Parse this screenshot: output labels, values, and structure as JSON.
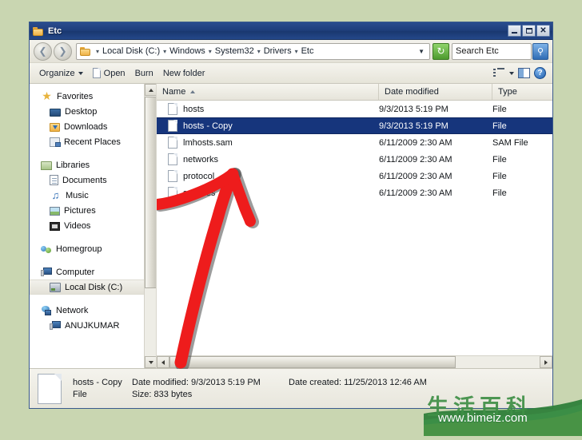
{
  "window": {
    "title": "Etc",
    "controls": {
      "minimize": "Minimize",
      "maximize": "Maximize",
      "close": "Close"
    }
  },
  "address_bar": {
    "back_label": "Back",
    "forward_label": "Forward",
    "breadcrumb": [
      "Local Disk (C:)",
      "Windows",
      "System32",
      "Drivers",
      "Etc"
    ],
    "separator": "▾",
    "dropdown_icon": "chevron-down",
    "refresh_icon": "↻"
  },
  "search": {
    "value": "Search Etc",
    "placeholder": "Search Etc",
    "icon": "search-icon"
  },
  "toolbar": {
    "organize_label": "Organize",
    "open_label": "Open",
    "burn_label": "Burn",
    "new_folder_label": "New folder",
    "view_icon": "list-view-icon",
    "view_dropdown_icon": "chevron-down-icon",
    "preview_pane_icon": "preview-pane-icon",
    "help_label": "?"
  },
  "sidebar": {
    "groups": [
      {
        "header": "Favorites",
        "header_icon": "star-icon",
        "items": [
          {
            "label": "Desktop",
            "icon": "monitor-icon"
          },
          {
            "label": "Downloads",
            "icon": "download-folder-icon"
          },
          {
            "label": "Recent Places",
            "icon": "recent-places-icon"
          }
        ]
      },
      {
        "header": "Libraries",
        "header_icon": "library-icon",
        "items": [
          {
            "label": "Documents",
            "icon": "document-icon"
          },
          {
            "label": "Music",
            "icon": "music-note-icon"
          },
          {
            "label": "Pictures",
            "icon": "picture-icon"
          },
          {
            "label": "Videos",
            "icon": "video-icon"
          }
        ]
      },
      {
        "header": "Homegroup",
        "header_icon": "homegroup-icon",
        "items": []
      },
      {
        "header": "Computer",
        "header_icon": "computer-icon",
        "items": [
          {
            "label": "Local Disk (C:)",
            "icon": "hard-drive-icon",
            "selected": true
          }
        ]
      },
      {
        "header": "Network",
        "header_icon": "network-icon",
        "items": [
          {
            "label": "ANUJKUMAR",
            "icon": "computer-icon"
          }
        ]
      }
    ]
  },
  "file_list": {
    "columns": [
      "Name",
      "Date modified",
      "Type"
    ],
    "sort_column": "Name",
    "sort_direction": "asc",
    "rows": [
      {
        "name": "hosts",
        "date_modified": "9/3/2013 5:19 PM",
        "type": "File",
        "selected": false
      },
      {
        "name": "hosts - Copy",
        "date_modified": "9/3/2013 5:19 PM",
        "type": "File",
        "selected": true
      },
      {
        "name": "lmhosts.sam",
        "date_modified": "6/11/2009 2:30 AM",
        "type": "SAM File",
        "selected": false
      },
      {
        "name": "networks",
        "date_modified": "6/11/2009 2:30 AM",
        "type": "File",
        "selected": false
      },
      {
        "name": "protocol",
        "date_modified": "6/11/2009 2:30 AM",
        "type": "File",
        "selected": false
      },
      {
        "name": "services",
        "date_modified": "6/11/2009 2:30 AM",
        "type": "File",
        "selected": false
      }
    ]
  },
  "details_pane": {
    "file_name": "hosts - Copy",
    "date_modified_label": "Date modified:",
    "date_modified_value": "9/3/2013 5:19 PM",
    "date_created_label": "Date created:",
    "date_created_value": "11/25/2013 12:46 AM",
    "type_value": "File",
    "size_label": "Size:",
    "size_value": "833 bytes"
  },
  "annotation": {
    "arrow_color": "#ee1c1c",
    "arrow_outline": "#4a4a4a",
    "description": "red-hand-drawn-arrow"
  },
  "watermark": {
    "chinese_text": "生活百科",
    "url": "www.bimeiz.com",
    "brand_color": "#3f8f46"
  }
}
